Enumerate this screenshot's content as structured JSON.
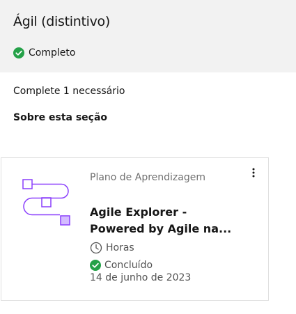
{
  "badge": {
    "title": "Ágil (distintivo)",
    "status": "Completo",
    "requirement": "Complete 1 necessário",
    "about_label": "Sobre esta seção"
  },
  "card": {
    "type_label": "Plano de Aprendizagem",
    "title": "Agile Explorer - Powered by Agile na...",
    "duration_label": "Horas",
    "status_label": "Concluído",
    "date": "14 de junho de 2023",
    "menu_icon": "overflow-menu-vertical-icon",
    "duration_icon": "clock-icon",
    "status_icon": "checkmark-filled-icon",
    "illustration_icon": "learning-plan-path-icon"
  },
  "colors": {
    "header_bg": "#f2f2f2",
    "success": "#24a148",
    "illustration": "#8a3ffc",
    "illustration_fill": "#d4bbff",
    "muted_text": "#6f6f6f"
  }
}
